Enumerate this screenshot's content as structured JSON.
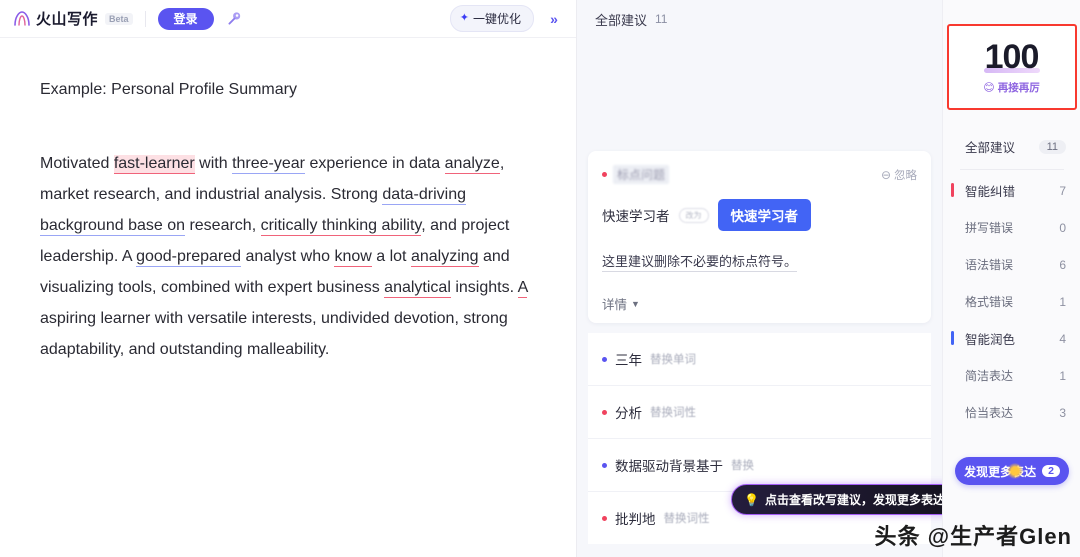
{
  "header": {
    "brand_name": "火山写作",
    "beta_label": "Beta",
    "login_label": "登录",
    "magic_icon": "magic-wand-icon",
    "optimize_label": "一键优化",
    "sparkle_icon": "sparkle-icon",
    "collapse_label": "»"
  },
  "document": {
    "title": "Example: Personal Profile Summary",
    "paragraph_runs": [
      {
        "t": "Motivated ",
        "s": "plain"
      },
      {
        "t": "fast-learner",
        "s": "red-hl"
      },
      {
        "t": " with ",
        "s": "plain"
      },
      {
        "t": "three-year",
        "s": "blue"
      },
      {
        "t": " experience in data ",
        "s": "plain"
      },
      {
        "t": "analyze",
        "s": "red"
      },
      {
        "t": ", market research, and industrial analysis. Strong ",
        "s": "plain"
      },
      {
        "t": "data-driving background base on",
        "s": "blue"
      },
      {
        "t": " research, ",
        "s": "plain"
      },
      {
        "t": "critically thinking ability",
        "s": "red"
      },
      {
        "t": ", and project leadership. A ",
        "s": "plain"
      },
      {
        "t": "good-prepared",
        "s": "blue"
      },
      {
        "t": " analyst who ",
        "s": "plain"
      },
      {
        "t": "know",
        "s": "red"
      },
      {
        "t": " a lot ",
        "s": "plain"
      },
      {
        "t": "analyzing",
        "s": "red"
      },
      {
        "t": " and visualizing tools, combined with expert business ",
        "s": "plain"
      },
      {
        "t": "analytical",
        "s": "red"
      },
      {
        "t": " insights. ",
        "s": "plain"
      },
      {
        "t": "A",
        "s": "red"
      },
      {
        "t": " aspiring learner with versatile interests, undivided devotion, strong adaptability, and outstanding malleability.",
        "s": "plain"
      }
    ]
  },
  "suggestions_panel": {
    "header_label": "全部建议",
    "header_count": "11",
    "main_card": {
      "category": "标点问题",
      "category_dot": "red",
      "ignore_label": "忽略",
      "ignore_icon": "minus-circle-icon",
      "original_text": "快速学习者",
      "arrow_icon": "arrow-right-icon",
      "replacement_text": "快速学习者",
      "description": "这里建议删除不必要的标点符号。",
      "detail_label": "详情",
      "detail_chevron": "chevron-down-icon"
    },
    "items": [
      {
        "dot": "blue",
        "text": "三年",
        "action": "替换单词"
      },
      {
        "dot": "red",
        "text": "分析",
        "action": "替换词性"
      },
      {
        "dot": "blue",
        "text": "数据驱动背景基于",
        "action": "替换"
      },
      {
        "dot": "red",
        "text": "批判地",
        "action": "替换词性"
      }
    ],
    "tooltip": {
      "icon": "lightbulb-icon",
      "text": "点击查看改写建议，发现更多表达"
    }
  },
  "sidebar": {
    "score": {
      "value": "100",
      "emoji": "😊",
      "caption": "再接再厉"
    },
    "rows": [
      {
        "label": "全部建议",
        "count": "11",
        "style": "pill",
        "bar": "none"
      },
      {
        "label": "智能纠错",
        "count": "7",
        "style": "num",
        "bar": "red"
      },
      {
        "label": "拼写错误",
        "count": "0",
        "style": "num",
        "bar": "none",
        "sub": true
      },
      {
        "label": "语法错误",
        "count": "6",
        "style": "num",
        "bar": "none",
        "sub": true
      },
      {
        "label": "格式错误",
        "count": "1",
        "style": "num",
        "bar": "none",
        "sub": true
      },
      {
        "label": "智能润色",
        "count": "4",
        "style": "num",
        "bar": "blue"
      },
      {
        "label": "简洁表达",
        "count": "1",
        "style": "num",
        "bar": "none",
        "sub": true
      },
      {
        "label": "恰当表达",
        "count": "3",
        "style": "num",
        "bar": "none",
        "sub": true
      }
    ],
    "more_button": {
      "label": "发现更多表达",
      "count": "2"
    }
  },
  "watermark": {
    "text": "头条 @生产者Glen"
  },
  "colors": {
    "brand_purple": "#5a54f0",
    "accent_blue": "#4264f5",
    "error_red": "#f0435e",
    "highlight_box": "#f8392f"
  }
}
